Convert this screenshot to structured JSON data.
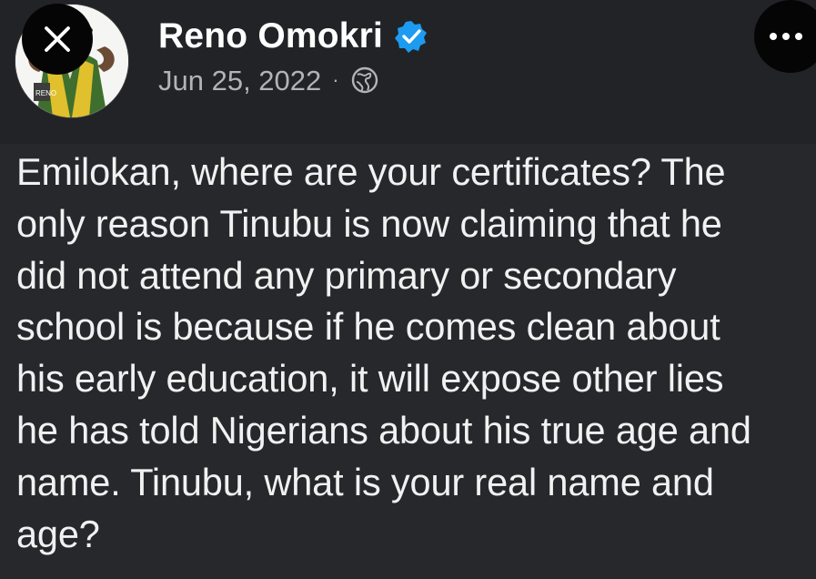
{
  "post": {
    "author_name": "Reno Omokri",
    "date": "Jun 25, 2022",
    "meta_separator": "·",
    "body_text": "Emilokan, where are your certificates? The\nonly reason Tinubu is now claiming that he\ndid not attend any primary or secondary\nschool is because if he comes clean about\nhis early education, it will expose other lies\nhe has told Nigerians about his true age and\nname. Tinubu, what is your real name and\nage?",
    "avatar_badge_text": "RENO"
  },
  "icons": {
    "close": "close-icon",
    "verified": "verified-badge-icon",
    "audience": "globe-icon",
    "more": "more-options-icon"
  },
  "colors": {
    "background": "#222326",
    "text": "#f1f1f1",
    "secondary_text": "#b1b3b8",
    "verified_blue": "#1d9bf0",
    "overlay_button": "#050505"
  }
}
